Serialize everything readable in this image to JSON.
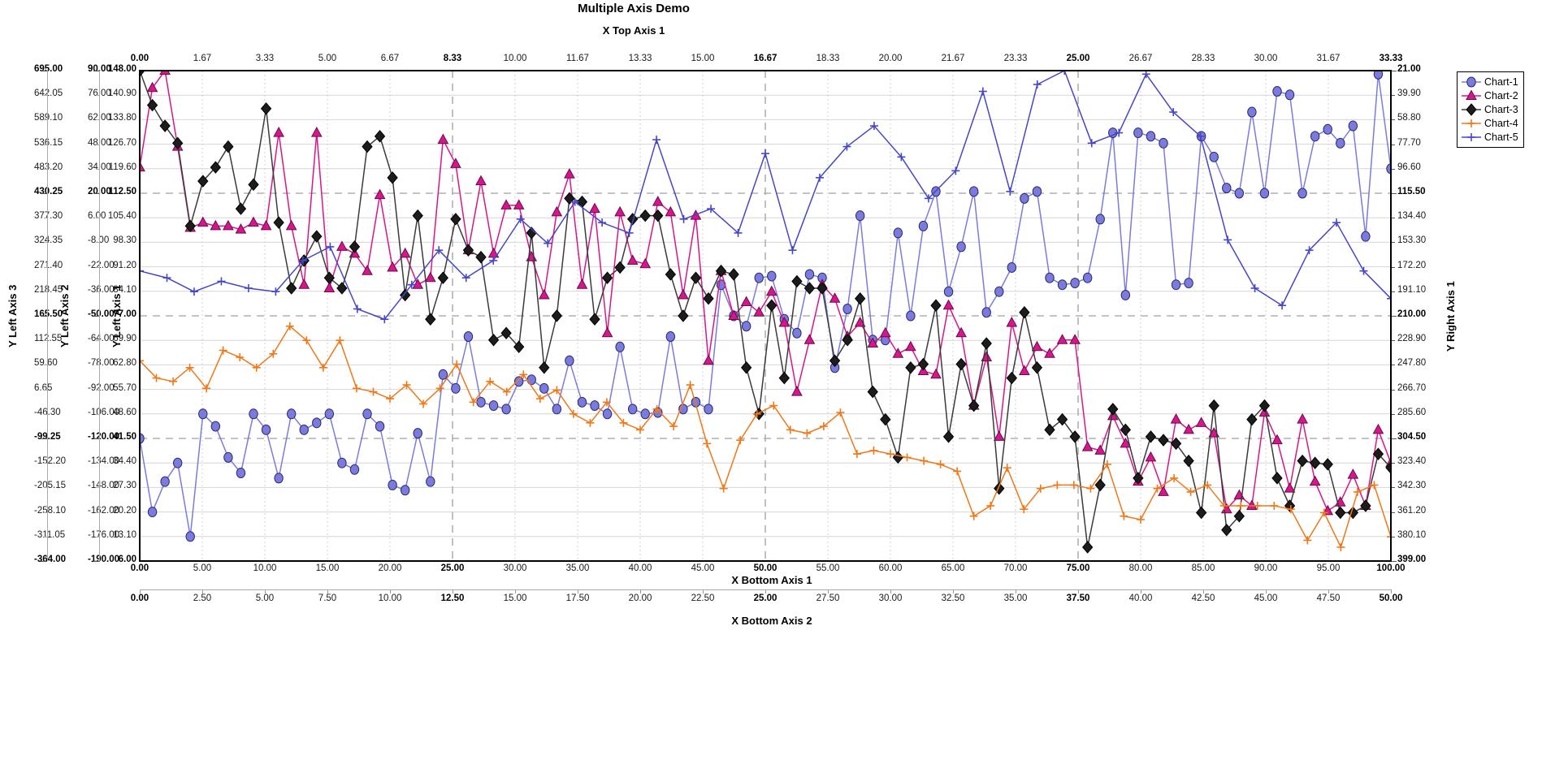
{
  "title": "Multiple Axis Demo",
  "top_axis": {
    "title": "X Top Axis 1"
  },
  "bottom_axis_1": {
    "title": "X Bottom Axis 1"
  },
  "bottom_axis_2": {
    "title": "X Bottom Axis 2"
  },
  "left_axis_1": {
    "title": "Y Left Axis 1"
  },
  "left_axis_2": {
    "title": "Y Left Axis 2"
  },
  "left_axis_3": {
    "title": "Y Left Axis 3"
  },
  "right_axis_1": {
    "title": "Y Right Axis 1"
  },
  "legend": {
    "items": [
      {
        "label": "Chart-1",
        "color": "#7b7bdd",
        "marker": "circle"
      },
      {
        "label": "Chart-2",
        "color": "#d6168c",
        "marker": "triangle"
      },
      {
        "label": "Chart-3",
        "color": "#3a3a3a",
        "marker": "diamond"
      },
      {
        "label": "Chart-4",
        "color": "#f07818",
        "marker": "plus"
      },
      {
        "label": "Chart-5",
        "color": "#4646c8",
        "marker": "plus"
      }
    ]
  },
  "chart_data": {
    "type": "line",
    "title": "Multiple Axis Demo",
    "grid": true,
    "legend_position": "right",
    "axes": {
      "x_top_1": {
        "label": "X Top Axis 1",
        "range": [
          0.0,
          33.33
        ],
        "ticks": [
          0.0,
          1.67,
          3.33,
          5.0,
          6.67,
          8.33,
          10.0,
          11.67,
          13.33,
          15.0,
          16.67,
          18.33,
          20.0,
          21.67,
          23.33,
          25.0,
          26.67,
          28.33,
          30.0,
          31.67,
          33.33
        ],
        "tick_labels": [
          "0.00",
          "1.67",
          "3.33",
          "5.00",
          "6.67",
          "8.33",
          "10.00",
          "11.67",
          "13.33",
          "15.00",
          "16.67",
          "18.33",
          "20.00",
          "21.67",
          "23.33",
          "25.00",
          "26.67",
          "28.33",
          "30.00",
          "31.67",
          "33.33"
        ],
        "major_ticks": [
          "0.00",
          "8.33",
          "16.67",
          "25.00",
          "33.33"
        ]
      },
      "x_bottom_1": {
        "label": "X Bottom Axis 1",
        "range": [
          0.0,
          100.0
        ],
        "ticks": [
          0,
          5,
          10,
          15,
          20,
          25,
          30,
          35,
          40,
          45,
          50,
          55,
          60,
          65,
          70,
          75,
          80,
          85,
          90,
          95,
          100
        ],
        "tick_labels": [
          "0.00",
          "5.00",
          "10.00",
          "15.00",
          "20.00",
          "25.00",
          "30.00",
          "35.00",
          "40.00",
          "45.00",
          "50.00",
          "55.00",
          "60.00",
          "65.00",
          "70.00",
          "75.00",
          "80.00",
          "85.00",
          "90.00",
          "95.00",
          "100.00"
        ],
        "major_ticks": [
          "0.00",
          "25.00",
          "50.00",
          "75.00",
          "100.00"
        ]
      },
      "x_bottom_2": {
        "label": "X Bottom Axis 2",
        "range": [
          0.0,
          50.0
        ],
        "ticks": [
          0,
          2.5,
          5,
          7.5,
          10,
          12.5,
          15,
          17.5,
          20,
          22.5,
          25,
          27.5,
          30,
          32.5,
          35,
          37.5,
          40,
          42.5,
          45,
          47.5,
          50
        ],
        "tick_labels": [
          "0.00",
          "2.50",
          "5.00",
          "7.50",
          "10.00",
          "12.50",
          "15.00",
          "17.50",
          "20.00",
          "22.50",
          "25.00",
          "27.50",
          "30.00",
          "32.50",
          "35.00",
          "37.50",
          "40.00",
          "42.50",
          "45.00",
          "47.50",
          "50.00"
        ],
        "major_ticks": [
          "0.00",
          "12.50",
          "25.00",
          "37.50",
          "50.00"
        ]
      },
      "y_left_1": {
        "label": "Y Left Axis 1",
        "range": [
          6.0,
          148.0
        ],
        "tick_labels": [
          "148.00",
          "140.90",
          "133.80",
          "126.70",
          "119.60",
          "112.50",
          "105.40",
          "98.30",
          "91.20",
          "84.10",
          "77.00",
          "69.90",
          "62.80",
          "55.70",
          "48.60",
          "41.50",
          "34.40",
          "27.30",
          "20.20",
          "13.10",
          "6.00"
        ],
        "major_ticks": [
          "148.00",
          "112.50",
          "77.00",
          "41.50",
          "6.00"
        ]
      },
      "y_left_2": {
        "label": "Y Left Axis 2",
        "range": [
          -190.0,
          90.0
        ],
        "tick_labels": [
          "90.00",
          "76.00",
          "62.00",
          "48.00",
          "34.00",
          "20.00",
          "6.00",
          "-8.00",
          "-22.00",
          "-36.00",
          "-50.00",
          "-64.00",
          "-78.00",
          "-92.00",
          "-106.00",
          "-120.00",
          "-134.00",
          "-148.00",
          "-162.00",
          "-176.00",
          "-190.00"
        ],
        "major_ticks": [
          "90.00",
          "20.00",
          "-50.00",
          "-120.00",
          "-190.00"
        ]
      },
      "y_left_3": {
        "label": "Y Left Axis 3",
        "range": [
          -364.0,
          695.0
        ],
        "tick_labels": [
          "695.00",
          "642.05",
          "589.10",
          "536.15",
          "483.20",
          "430.25",
          "377.30",
          "324.35",
          "271.40",
          "218.45",
          "165.50",
          "112.55",
          "59.60",
          "6.65",
          "-46.30",
          "-99.25",
          "-152.20",
          "-205.15",
          "-258.10",
          "-311.05",
          "-364.00"
        ],
        "major_ticks": [
          "695.00",
          "430.25",
          "165.50",
          "-99.25",
          "-364.00"
        ]
      },
      "y_right_1": {
        "label": "Y Right Axis 1",
        "range": [
          21.0,
          399.0
        ],
        "inverted": true,
        "tick_labels": [
          "21.00",
          "39.90",
          "58.80",
          "77.70",
          "96.60",
          "115.50",
          "134.40",
          "153.30",
          "172.20",
          "191.10",
          "210.00",
          "228.90",
          "247.80",
          "266.70",
          "285.60",
          "304.50",
          "323.40",
          "342.30",
          "361.20",
          "380.10",
          "399.00"
        ],
        "major_ticks": [
          "21.00",
          "115.50",
          "210.00",
          "304.50",
          "399.00"
        ]
      }
    },
    "series": [
      {
        "name": "Chart-1",
        "color": "#7b7bdd",
        "marker": "circle",
        "y_axis": "y_left_1",
        "x_axis": "x_bottom_1",
        "values": [
          41.5,
          20.2,
          29.0,
          34.4,
          13.1,
          48.6,
          45.0,
          36.0,
          31.5,
          48.6,
          44.0,
          30.0,
          48.6,
          44.0,
          46.0,
          48.6,
          34.4,
          32.5,
          48.6,
          45.0,
          28.0,
          26.5,
          43.0,
          29.0,
          60.0,
          56.0,
          71.0,
          52.0,
          51.0,
          50.0,
          58.0,
          58.5,
          56.0,
          50.0,
          64.0,
          52.0,
          51.0,
          48.6,
          68.0,
          50.0,
          48.6,
          49.0,
          71.0,
          50.0,
          52.0,
          50.0,
          86.0,
          77.0,
          74.0,
          88.0,
          88.5,
          76.0,
          72.0,
          89.0,
          88.0,
          62.0,
          79.0,
          106.0,
          70.0,
          70.0,
          101.0,
          77.0,
          103.0,
          113.0,
          84.0,
          97.0,
          113.0,
          78.0,
          84.0,
          91.0,
          111.0,
          113.0,
          88.0,
          86.0,
          86.5,
          88.0,
          105.0,
          130.0,
          83.0,
          130.0,
          129.0,
          127.0,
          86.0,
          86.5,
          129.0,
          123.0,
          114.0,
          112.5,
          136.0,
          112.5,
          142.0,
          141.0,
          112.5,
          129.0,
          131.0,
          127.0,
          132.0,
          100.0,
          147.0,
          119.6
        ]
      },
      {
        "name": "Chart-2",
        "color": "#d6168c",
        "marker": "triangle",
        "y_axis": "y_left_1",
        "x_axis": "x_bottom_1",
        "values": [
          120.0,
          143.0,
          148.0,
          126.0,
          102.5,
          104.0,
          103.0,
          103.0,
          102.0,
          104.0,
          103.0,
          130.0,
          103.0,
          86.0,
          130.0,
          85.0,
          97.0,
          95.0,
          90.0,
          112.0,
          91.0,
          95.0,
          86.0,
          88.0,
          128.0,
          121.0,
          96.0,
          116.0,
          95.0,
          109.0,
          109.0,
          94.0,
          83.0,
          107.0,
          118.0,
          86.0,
          108.0,
          72.0,
          107.0,
          93.0,
          92.0,
          110.0,
          107.0,
          83.0,
          106.0,
          64.0,
          90.0,
          77.0,
          81.0,
          78.0,
          84.0,
          75.0,
          55.0,
          70.0,
          86.0,
          82.0,
          71.0,
          75.0,
          69.0,
          72.0,
          66.0,
          68.0,
          61.0,
          60.0,
          80.0,
          72.0,
          51.0,
          65.0,
          42.0,
          75.0,
          61.0,
          68.0,
          66.0,
          70.0,
          70.0,
          39.0,
          38.0,
          48.0,
          40.0,
          29.0,
          36.0,
          26.0,
          47.0,
          44.0,
          46.0,
          43.0,
          21.0,
          25.0,
          22.0,
          49.0,
          41.0,
          27.0,
          47.0,
          29.0,
          20.5,
          23.0,
          31.0,
          22.0,
          44.0,
          34.4
        ]
      },
      {
        "name": "Chart-3",
        "color": "#3a3a3a",
        "marker": "diamond",
        "y_axis": "y_left_1",
        "x_axis": "x_bottom_1",
        "values": [
          148.0,
          138.0,
          132.0,
          127.0,
          103.0,
          116.0,
          120.0,
          126.0,
          108.0,
          115.0,
          137.0,
          104.0,
          85.0,
          93.0,
          100.0,
          88.0,
          85.0,
          97.0,
          126.0,
          129.0,
          117.0,
          83.0,
          106.0,
          76.0,
          88.0,
          105.0,
          96.0,
          94.0,
          70.0,
          72.0,
          68.0,
          101.0,
          62.0,
          77.0,
          111.0,
          110.0,
          76.0,
          88.0,
          91.0,
          105.0,
          106.0,
          106.0,
          89.0,
          77.0,
          88.0,
          82.0,
          90.0,
          89.0,
          62.0,
          48.6,
          80.0,
          59.0,
          87.0,
          85.0,
          85.0,
          64.0,
          70.0,
          82.0,
          55.0,
          47.0,
          36.0,
          62.0,
          63.0,
          80.0,
          42.0,
          63.0,
          51.0,
          69.0,
          27.0,
          59.0,
          78.0,
          62.0,
          44.0,
          47.0,
          42.0,
          10.0,
          28.0,
          50.0,
          44.0,
          30.0,
          42.0,
          41.0,
          40.0,
          35.0,
          20.0,
          51.0,
          15.0,
          19.0,
          47.0,
          51.0,
          30.0,
          22.0,
          35.0,
          34.4,
          34.0,
          20.0,
          20.0,
          22.0,
          37.0,
          33.0
        ]
      },
      {
        "name": "Chart-4",
        "color": "#f07818",
        "marker": "plus",
        "y_axis": "y_left_1",
        "x_axis": "x_bottom_1",
        "values": [
          64.0,
          59.0,
          58.0,
          62.0,
          56.0,
          67.0,
          65.0,
          62.0,
          66.0,
          74.0,
          69.9,
          62.0,
          69.9,
          56.0,
          55.0,
          53.0,
          57.0,
          51.5,
          56.0,
          63.0,
          52.0,
          58.0,
          55.0,
          60.0,
          53.0,
          55.5,
          48.6,
          46.0,
          52.0,
          46.0,
          44.0,
          50.0,
          45.0,
          57.0,
          40.0,
          27.0,
          41.0,
          48.6,
          51.0,
          44.0,
          43.0,
          45.0,
          49.0,
          37.0,
          38.0,
          37.0,
          36.0,
          35.0,
          34.0,
          32.0,
          19.0,
          22.0,
          33.0,
          21.0,
          27.0,
          28.0,
          28.0,
          27.0,
          34.0,
          19.0,
          18.0,
          27.0,
          30.0,
          26.0,
          28.0,
          22.0,
          22.0,
          22.0,
          22.0,
          21.0,
          12.0,
          20.0,
          10.0,
          26.0,
          28.0,
          13.0
        ]
      },
      {
        "name": "Chart-5",
        "color": "#4646c8",
        "marker": "plus",
        "y_axis": "y_left_1",
        "x_axis": "x_bottom_1",
        "values": [
          90.0,
          88.0,
          84.0,
          87.0,
          85.0,
          84.0,
          93.0,
          97.0,
          79.0,
          76.0,
          86.0,
          96.0,
          88.0,
          93.0,
          105.0,
          98.0,
          110.0,
          104.0,
          101.0,
          128.0,
          105.0,
          108.0,
          101.0,
          124.0,
          96.0,
          117.0,
          126.0,
          132.0,
          123.0,
          111.0,
          119.0,
          142.0,
          113.0,
          144.0,
          148.0,
          127.0,
          130.0,
          147.0,
          136.0,
          129.0,
          99.0,
          85.0,
          80.0,
          96.0,
          104.0,
          90.0,
          82.0
        ]
      }
    ]
  }
}
